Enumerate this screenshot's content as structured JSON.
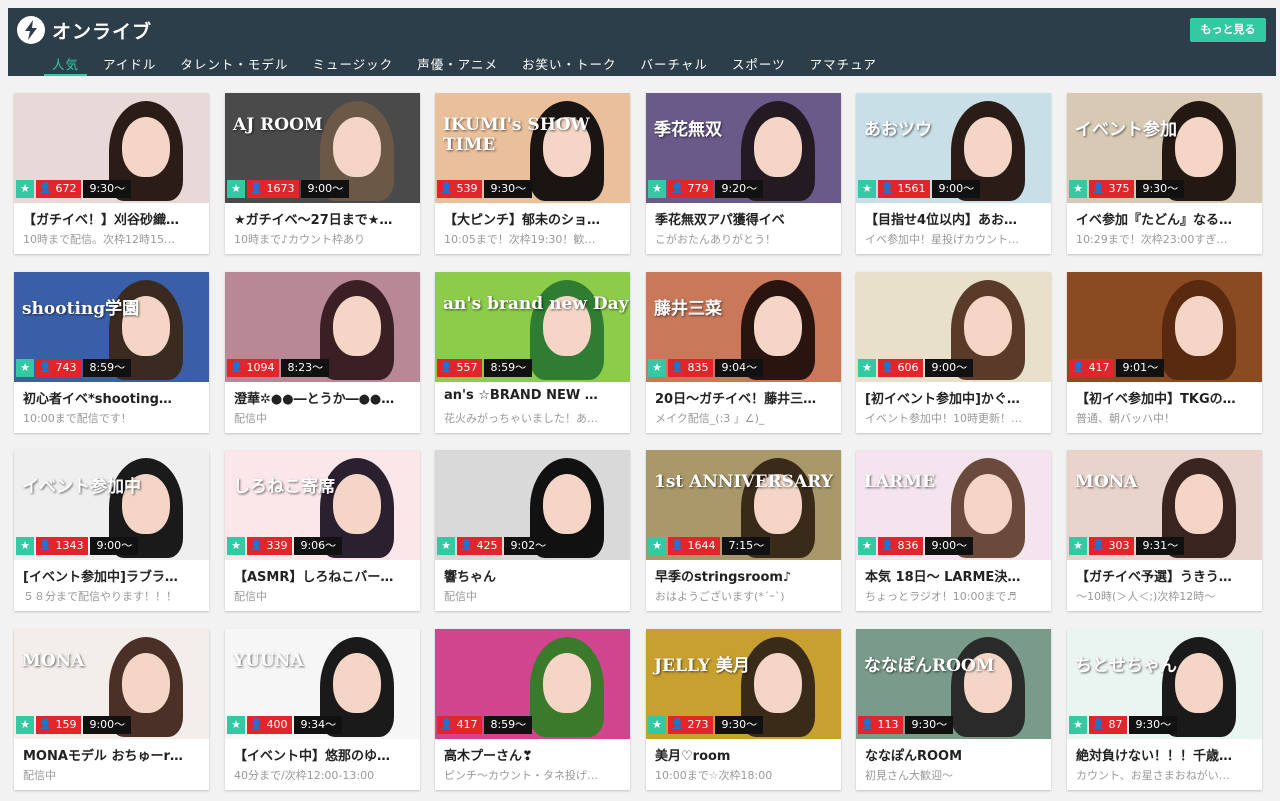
{
  "header": {
    "title": "オンライブ",
    "more_label": "もっと見る",
    "tabs": [
      "人気",
      "アイドル",
      "タレント・モデル",
      "ミュージック",
      "声優・アニメ",
      "お笑い・トーク",
      "バーチャル",
      "スポーツ",
      "アマチュア"
    ],
    "active_tab": "人気"
  },
  "colors": {
    "header_bg": "#2c3e4a",
    "accent": "#33c9a2",
    "viewer_badge": "#e2242b",
    "time_badge": "#111111"
  },
  "cards": [
    {
      "title": "【ガチイベ！】刈谷砂織…",
      "sub": "10時まで配信。次枠12時15…",
      "viewers": "672",
      "time": "9:30〜",
      "star": true,
      "thumb_text": "",
      "bg": "#e8d8d8",
      "hair": "#2a1c17"
    },
    {
      "title": "★ガチイベ〜27日まで★…",
      "sub": "10時まで♪カウント枠あり",
      "viewers": "1673",
      "time": "9:00〜",
      "star": true,
      "thumb_text": "AJ ROOM",
      "bg": "#4a4a4a",
      "hair": "#6b5846"
    },
    {
      "title": "【大ピンチ】郁未のショ…",
      "sub": "10:05まで！次枠19:30！歓…",
      "viewers": "539",
      "time": "9:30〜",
      "star": false,
      "thumb_text": "IKUMI's SHOW TIME",
      "bg": "#e9c09b",
      "hair": "#1a1412"
    },
    {
      "title": "季花無双アパ獲得イベ",
      "sub": "こがおたんありがとう！",
      "viewers": "779",
      "time": "9:20〜",
      "star": true,
      "thumb_text": "季花無双",
      "bg": "#6a5a8a",
      "hair": "#241a22"
    },
    {
      "title": "【目指せ4位以内】あお…",
      "sub": "イベ参加中！星投げカウント…",
      "viewers": "1561",
      "time": "9:00〜",
      "star": true,
      "thumb_text": "あおツウ",
      "bg": "#c9dfe8",
      "hair": "#2a1c17"
    },
    {
      "title": "イベ参加『たどん』なる…",
      "sub": "10:29まで！次枠23:00すぎ…",
      "viewers": "375",
      "time": "9:30〜",
      "star": true,
      "thumb_text": "イベント参加",
      "bg": "#d8c9b5",
      "hair": "#241812"
    },
    {
      "title": "初心者イベ*shooting…",
      "sub": "10:00まで配信です！",
      "viewers": "743",
      "time": "8:59〜",
      "star": true,
      "thumb_text": "shooting学園",
      "bg": "#3a5fa8",
      "hair": "#3a2a20"
    },
    {
      "title": "澄華✲●●―とうか―●●…",
      "sub": "配信中",
      "viewers": "1094",
      "time": "8:23〜",
      "star": false,
      "thumb_text": "",
      "bg": "#b88896",
      "hair": "#3a2024"
    },
    {
      "title": "an's ☆BRAND NEW …",
      "sub": "花火みがっちゃいました！あ…",
      "viewers": "557",
      "time": "8:59〜",
      "star": false,
      "thumb_text": "an's brand new Day",
      "bg": "#8ccc4a",
      "hair": "#2e7d32"
    },
    {
      "title": "20日〜ガチイベ！藤井三…",
      "sub": "メイク配信_(:3 」∠)_",
      "viewers": "835",
      "time": "9:04〜",
      "star": true,
      "thumb_text": "藤井三菜",
      "bg": "#c9785a",
      "hair": "#2a1410"
    },
    {
      "title": "[初イベント参加中]かぐ…",
      "sub": "イベント参加中！10時更新！…",
      "viewers": "606",
      "time": "9:00〜",
      "star": true,
      "thumb_text": "",
      "bg": "#e9e0cc",
      "hair": "#5a3a28"
    },
    {
      "title": "【初イベ参加中】TKGの…",
      "sub": "普通、朝バッハ中！",
      "viewers": "417",
      "time": "9:01〜",
      "star": false,
      "thumb_text": "",
      "bg": "#8a4a22",
      "hair": "#5a2a10"
    },
    {
      "title": "[イベント参加中]ラブラ…",
      "sub": "５８分まで配信やります！！！",
      "viewers": "1343",
      "time": "9:00〜",
      "star": true,
      "thumb_text": "イベント参加中",
      "bg": "#efefef",
      "hair": "#1a1a1a"
    },
    {
      "title": "【ASMR】しろねこバー…",
      "sub": "配信中",
      "viewers": "339",
      "time": "9:06〜",
      "star": true,
      "thumb_text": "しろねこ寄席",
      "bg": "#fbe7ea",
      "hair": "#2a2030"
    },
    {
      "title": "響ちゃん",
      "sub": "配信中",
      "viewers": "425",
      "time": "9:02〜",
      "star": true,
      "thumb_text": "",
      "bg": "#d9d9d9",
      "hair": "#111111"
    },
    {
      "title": "早季のstringsroom♪",
      "sub": "おはようございます(*´ｰ`)",
      "viewers": "1644",
      "time": "7:15〜",
      "star": true,
      "thumb_text": "1st ANNIVERSARY",
      "bg": "#a9986a",
      "hair": "#3a2a1a"
    },
    {
      "title": "本気 18日〜 LARME決…",
      "sub": "ちょっとラジオ！10:00まで♬",
      "viewers": "836",
      "time": "9:00〜",
      "star": true,
      "thumb_text": "LARME",
      "bg": "#f4e4ee",
      "hair": "#6a4a3a"
    },
    {
      "title": "【ガチイベ予選】うきう…",
      "sub": "〜10時(＞人＜;)次枠12時〜",
      "viewers": "303",
      "time": "9:31〜",
      "star": true,
      "thumb_text": "MONA",
      "bg": "#e8d4cc",
      "hair": "#3a2420"
    },
    {
      "title": "MONAモデル おちゅーr…",
      "sub": "配信中",
      "viewers": "159",
      "time": "9:00〜",
      "star": true,
      "thumb_text": "MONA",
      "bg": "#f3eeea",
      "hair": "#4a3026"
    },
    {
      "title": "【イベント中】悠那のゆ…",
      "sub": "40分まで/次枠12:00-13:00",
      "viewers": "400",
      "time": "9:34〜",
      "star": true,
      "thumb_text": "YUUNA",
      "bg": "#f6f6f6",
      "hair": "#1a1a1a"
    },
    {
      "title": "高木プーさん❣",
      "sub": "ピンチ〜カウント・タネ投げ…",
      "viewers": "417",
      "time": "8:59〜",
      "star": false,
      "thumb_text": "",
      "bg": "#d0458e",
      "hair": "#3a7a2a"
    },
    {
      "title": "美月♡room",
      "sub": "10:00まで☆次枠18:00",
      "viewers": "273",
      "time": "9:30〜",
      "star": true,
      "thumb_text": "JELLY 美月",
      "bg": "#c8a030",
      "hair": "#3a2a18"
    },
    {
      "title": "ななぽんROOM",
      "sub": "初見さん大歓迎〜",
      "viewers": "113",
      "time": "9:30〜",
      "star": false,
      "thumb_text": "ななぽんROOM",
      "bg": "#7a9a8a",
      "hair": "#2a2a2a"
    },
    {
      "title": "絶対負けない！！！千歳…",
      "sub": "カウント、お星さまおねがい…",
      "viewers": "87",
      "time": "9:30〜",
      "star": true,
      "thumb_text": "ちとせちゃん",
      "bg": "#eaf4f0",
      "hair": "#1a1a1a"
    }
  ]
}
